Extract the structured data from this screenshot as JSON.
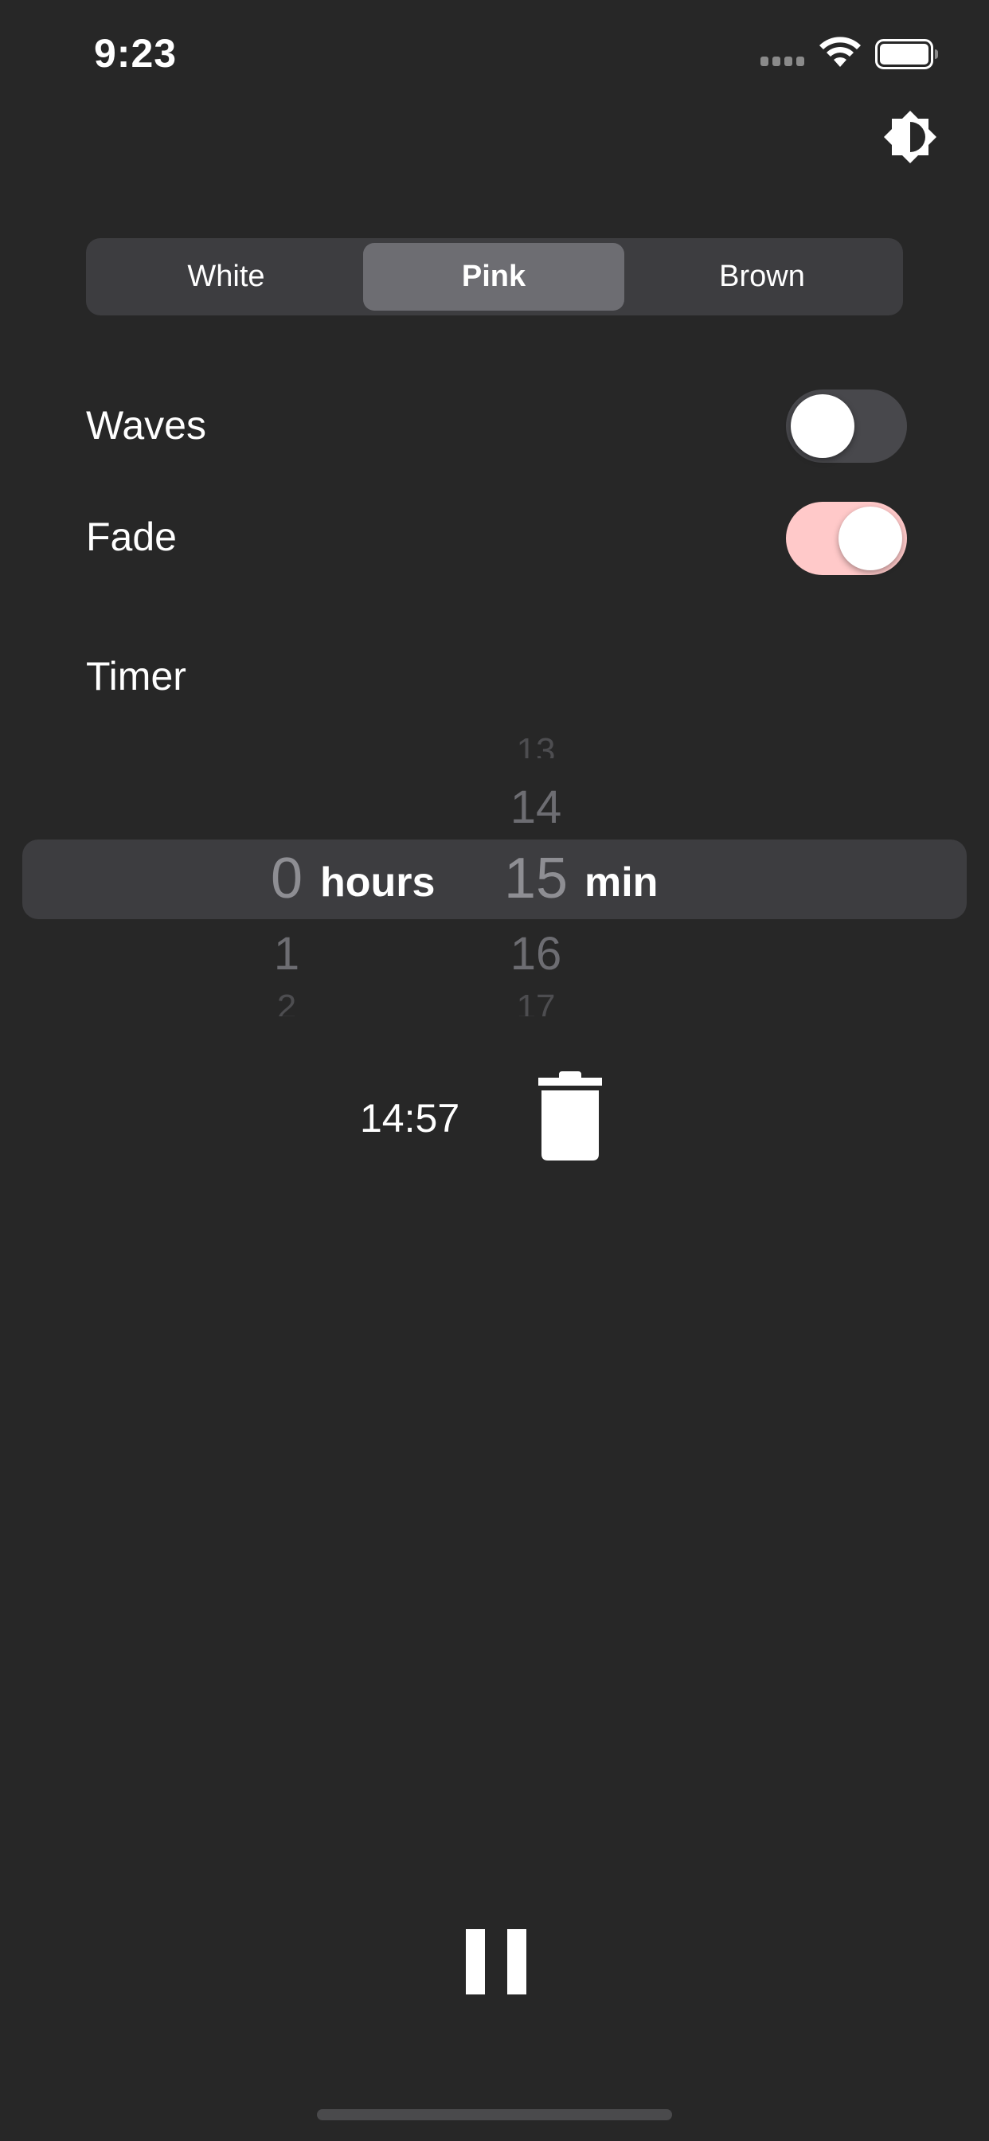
{
  "status_bar": {
    "time": "9:23"
  },
  "icons": {
    "signal": "cellular-signal-icon",
    "wifi": "wifi-icon",
    "battery": "battery-icon",
    "theme": "brightness-toggle-icon",
    "trash": "trash-icon",
    "pause": "pause-icon"
  },
  "noise_selector": {
    "options": [
      "White",
      "Pink",
      "Brown"
    ],
    "selected": "Pink"
  },
  "settings": {
    "waves_label": "Waves",
    "waves_on": false,
    "fade_label": "Fade",
    "fade_on": true,
    "fade_color": "#ffc9c9"
  },
  "timer": {
    "label": "Timer",
    "hours": {
      "selected": "0",
      "below": [
        "1",
        "2"
      ],
      "unit": "hours"
    },
    "minutes": {
      "above": [
        "13",
        "14"
      ],
      "selected": "15",
      "below": [
        "16",
        "17"
      ],
      "unit": "min"
    },
    "remaining": "14:57"
  },
  "colors": {
    "background": "#272727",
    "control_bg": "#3d3d40",
    "segment_selected": "#6d6d72",
    "accent": "#ffc9c9"
  }
}
